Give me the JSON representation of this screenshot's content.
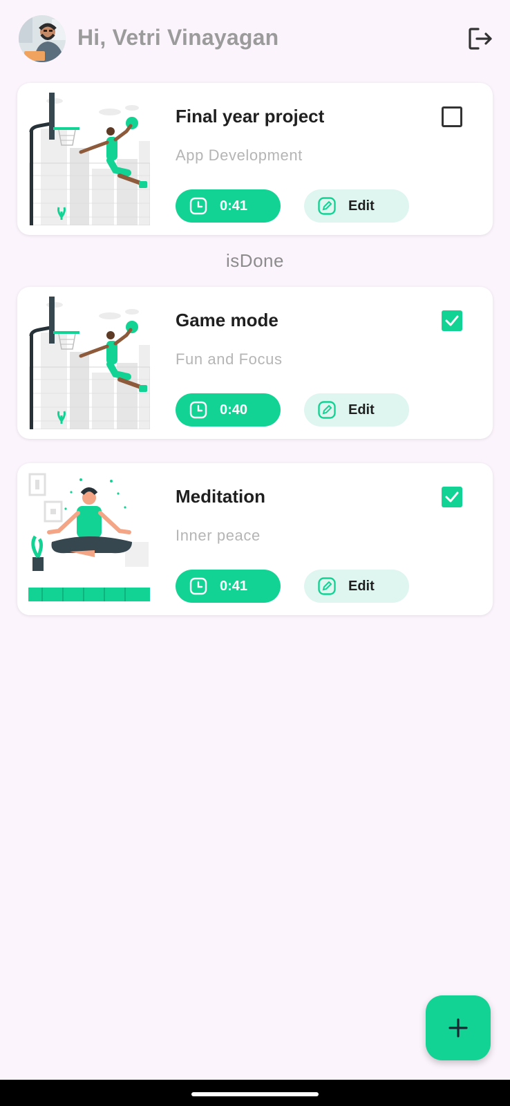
{
  "header": {
    "greeting": "Hi, Vetri Vinayagan",
    "avatar": "user-avatar-photo",
    "logout_icon": "logout-icon"
  },
  "tasks_active": [
    {
      "title": "Final year project",
      "subtitle": "App Development",
      "time": "0:41",
      "edit_label": "Edit",
      "done": false,
      "illustration": "basketball-dunk-illustration"
    }
  ],
  "section_label": "isDone",
  "tasks_done": [
    {
      "title": "Game mode",
      "subtitle": "Fun and Focus",
      "time": "0:40",
      "edit_label": "Edit",
      "done": true,
      "illustration": "basketball-dunk-illustration"
    },
    {
      "title": "Meditation",
      "subtitle": "Inner peace",
      "time": "0:41",
      "edit_label": "Edit",
      "done": true,
      "illustration": "meditation-illustration"
    }
  ],
  "fab": {
    "icon": "plus-icon"
  },
  "colors": {
    "accent": "#12d394",
    "background": "#fcf4fc",
    "edit_button_bg": "#dff5f0",
    "title": "#1f1f1f",
    "subtitle": "#b5b5b5"
  }
}
